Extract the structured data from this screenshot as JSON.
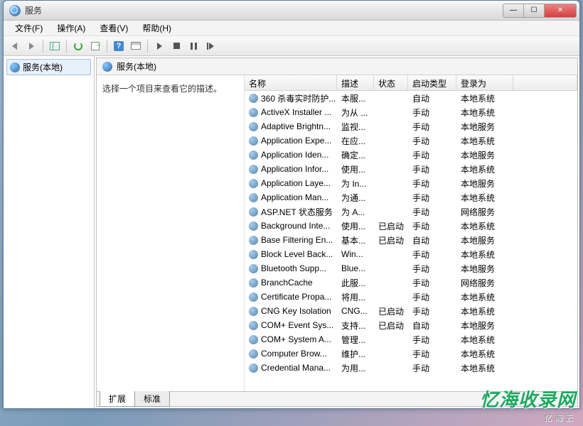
{
  "window": {
    "title": "服务"
  },
  "menu": {
    "file": "文件(F)",
    "action": "操作(A)",
    "view": "查看(V)",
    "help": "帮助(H)"
  },
  "tree": {
    "root": "服务(本地)"
  },
  "pane": {
    "title": "服务(本地)",
    "desc_hint": "选择一个项目来查看它的描述。"
  },
  "columns": {
    "name": "名称",
    "desc": "描述",
    "status": "状态",
    "startup": "启动类型",
    "logon": "登录为"
  },
  "tabs": {
    "extended": "扩展",
    "standard": "标准"
  },
  "services": [
    {
      "name": "360 杀毒实时防护...",
      "desc": "本服...",
      "status": "",
      "startup": "自动",
      "logon": "本地系统"
    },
    {
      "name": "ActiveX Installer ...",
      "desc": "为从 ...",
      "status": "",
      "startup": "手动",
      "logon": "本地系统"
    },
    {
      "name": "Adaptive Brightn...",
      "desc": "监视...",
      "status": "",
      "startup": "手动",
      "logon": "本地服务"
    },
    {
      "name": "Application Expe...",
      "desc": "在应...",
      "status": "",
      "startup": "手动",
      "logon": "本地系统"
    },
    {
      "name": "Application Iden...",
      "desc": "确定...",
      "status": "",
      "startup": "手动",
      "logon": "本地服务"
    },
    {
      "name": "Application Infor...",
      "desc": "使用...",
      "status": "",
      "startup": "手动",
      "logon": "本地系统"
    },
    {
      "name": "Application Laye...",
      "desc": "为 In...",
      "status": "",
      "startup": "手动",
      "logon": "本地服务"
    },
    {
      "name": "Application Man...",
      "desc": "为通...",
      "status": "",
      "startup": "手动",
      "logon": "本地系统"
    },
    {
      "name": "ASP.NET 状态服务",
      "desc": "为 A...",
      "status": "",
      "startup": "手动",
      "logon": "网络服务"
    },
    {
      "name": "Background Inte...",
      "desc": "使用...",
      "status": "已启动",
      "startup": "手动",
      "logon": "本地系统"
    },
    {
      "name": "Base Filtering En...",
      "desc": "基本...",
      "status": "已启动",
      "startup": "自动",
      "logon": "本地服务"
    },
    {
      "name": "Block Level Back...",
      "desc": "Win...",
      "status": "",
      "startup": "手动",
      "logon": "本地系统"
    },
    {
      "name": "Bluetooth Supp...",
      "desc": "Blue...",
      "status": "",
      "startup": "手动",
      "logon": "本地服务"
    },
    {
      "name": "BranchCache",
      "desc": "此服...",
      "status": "",
      "startup": "手动",
      "logon": "网络服务"
    },
    {
      "name": "Certificate Propa...",
      "desc": "将用...",
      "status": "",
      "startup": "手动",
      "logon": "本地系统"
    },
    {
      "name": "CNG Key Isolation",
      "desc": "CNG...",
      "status": "已启动",
      "startup": "手动",
      "logon": "本地系统"
    },
    {
      "name": "COM+ Event Sys...",
      "desc": "支持...",
      "status": "已启动",
      "startup": "自动",
      "logon": "本地服务"
    },
    {
      "name": "COM+ System A...",
      "desc": "管理...",
      "status": "",
      "startup": "手动",
      "logon": "本地系统"
    },
    {
      "name": "Computer Brow...",
      "desc": "维护...",
      "status": "",
      "startup": "手动",
      "logon": "本地系统"
    },
    {
      "name": "Credential Mana...",
      "desc": "为用...",
      "status": "",
      "startup": "手动",
      "logon": "本地系统"
    }
  ],
  "watermark": {
    "brand": "忆海收录网",
    "sub": "忆海云"
  }
}
